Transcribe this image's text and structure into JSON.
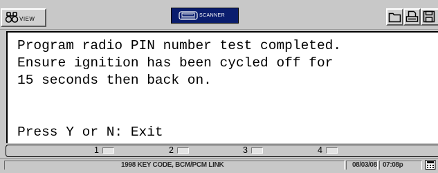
{
  "toolbar": {
    "view_label": "VIEW",
    "view_icon": "binoculars-icon",
    "scanner_label": "SCANNER",
    "scanner_icon": "scanner-device-icon",
    "folder_icon": "folder-icon",
    "print_icon": "printer-icon",
    "save_icon": "save-icon"
  },
  "message": {
    "lines": [
      "Program radio PIN number test completed.",
      "Ensure ignition has been cycled off for",
      "15 seconds then back on.",
      "",
      "Press Y or N: Exit"
    ]
  },
  "keys": [
    {
      "label": "1"
    },
    {
      "label": "2"
    },
    {
      "label": "3"
    },
    {
      "label": "4"
    }
  ],
  "status": {
    "description": "1998 KEY CODE, BCM/PCM LINK",
    "date": "08/03/08",
    "time": "07:08p",
    "corner_icon": "calculator-icon"
  },
  "colors": {
    "scanner_bg": "#0a1d6e",
    "panel_bg": "#c8c8c8",
    "message_bg": "#ffffff"
  }
}
